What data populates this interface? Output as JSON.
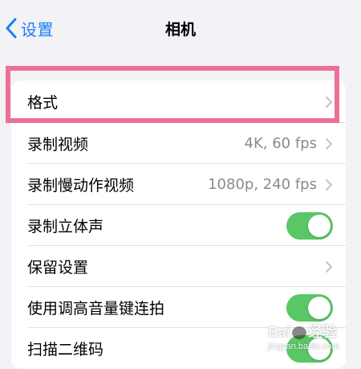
{
  "nav": {
    "back_label": "设置",
    "title": "相机"
  },
  "rows": [
    {
      "label": "格式",
      "value": "",
      "accessory": "chevron"
    },
    {
      "label": "录制视频",
      "value": "4K, 60 fps",
      "accessory": "chevron"
    },
    {
      "label": "录制慢动作视频",
      "value": "1080p, 240 fps",
      "accessory": "chevron"
    },
    {
      "label": "录制立体声",
      "value": "",
      "accessory": "toggle",
      "toggle_on": true
    },
    {
      "label": "保留设置",
      "value": "",
      "accessory": "chevron"
    },
    {
      "label": "使用调高音量键连拍",
      "value": "",
      "accessory": "toggle",
      "toggle_on": true
    },
    {
      "label": "扫描二维码",
      "value": "",
      "accessory": "toggle",
      "toggle_on": true
    }
  ],
  "watermark": {
    "logo_left": "Bai",
    "logo_right": "经验",
    "url": "jingyan.baidu.com"
  },
  "colors": {
    "accent": "#1a7ff6",
    "toggle_on": "#5ac767",
    "highlight": "#ee6f96",
    "background": "#f2f2f7",
    "secondary_text": "#8a8a8e"
  },
  "icons": {
    "back": "chevron-left-icon",
    "disclosure": "chevron-right-icon"
  }
}
